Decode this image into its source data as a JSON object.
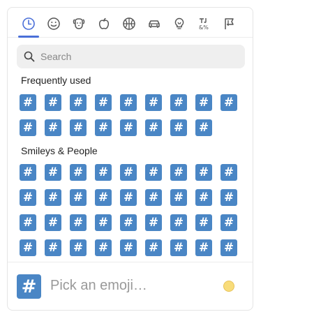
{
  "categories": [
    {
      "name": "frequently-used",
      "icon": "clock-icon",
      "active": true
    },
    {
      "name": "smileys-people",
      "icon": "smiley-icon"
    },
    {
      "name": "animals-nature",
      "icon": "dog-icon"
    },
    {
      "name": "food-drink",
      "icon": "apple-icon"
    },
    {
      "name": "activity",
      "icon": "ball-icon"
    },
    {
      "name": "travel-places",
      "icon": "car-icon"
    },
    {
      "name": "objects",
      "icon": "bulb-icon"
    },
    {
      "name": "symbols",
      "icon": "symbols-icon"
    },
    {
      "name": "flags",
      "icon": "flag-icon"
    }
  ],
  "search": {
    "placeholder": "Search"
  },
  "sections": {
    "frequent": {
      "label": "Frequently used",
      "count": 17
    },
    "smileys": {
      "label": "Smileys & People",
      "count": 36
    }
  },
  "emoji_glyph": "#",
  "footer": {
    "preview_glyph": "#",
    "preview_text": "Pick an emoji…"
  },
  "colors": {
    "accent": "#4a6fd8",
    "emoji_bg": "#4a86c5",
    "skin_tone": "#f8dc7a"
  }
}
